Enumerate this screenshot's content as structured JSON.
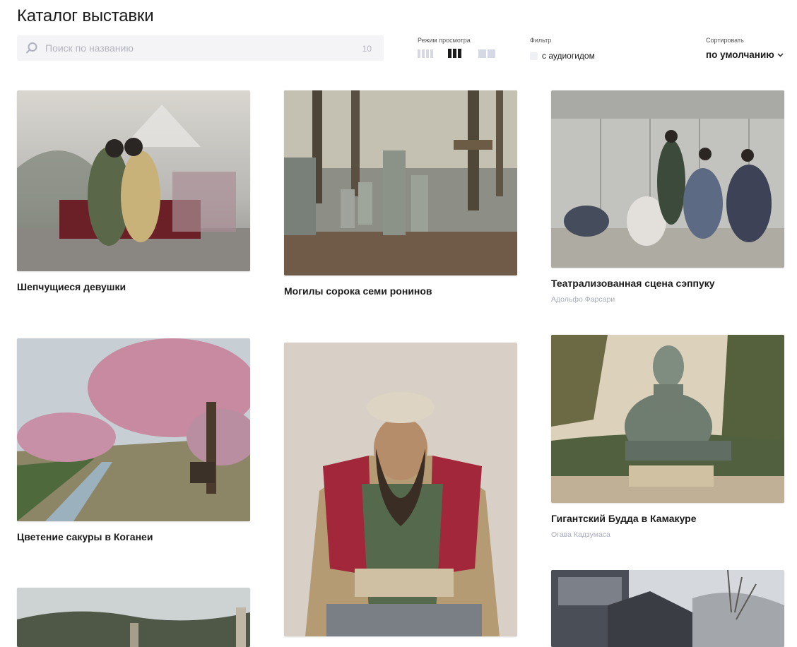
{
  "page": {
    "title": "Каталог выставки"
  },
  "search": {
    "placeholder": "Поиск по названию",
    "count": "10"
  },
  "view_mode": {
    "label": "Режим просмотра",
    "options": [
      "grid-4",
      "grid-3",
      "grid-2"
    ],
    "active": "grid-3"
  },
  "filter": {
    "label": "Фильтр",
    "option": "с аудиогидом",
    "checked": false
  },
  "sort": {
    "label": "Сортировать",
    "value": "по умолчанию"
  },
  "icons": {
    "search": "search-icon",
    "sort": "chevron-down-icon"
  },
  "colors": {
    "text": "#1c1c1c",
    "muted": "#a9acbb",
    "search_bg": "#f4f4f7",
    "inactive_view": "#d6d8e4"
  },
  "items": [
    {
      "title": "Шепчущиеся девушки",
      "author": ""
    },
    {
      "title": "Могилы сорока семи ронинов",
      "author": ""
    },
    {
      "title": "Театрализованная сцена сэппуку",
      "author": "Адольфо Фарсари"
    },
    {
      "title": "Цветение сакуры в Коганеи",
      "author": ""
    },
    {
      "title": "",
      "author": ""
    },
    {
      "title": "Гигантский Будда в Камакуре",
      "author": "Огава Кадзумаса"
    },
    {
      "title": "",
      "author": ""
    },
    {
      "title": "",
      "author": ""
    }
  ]
}
